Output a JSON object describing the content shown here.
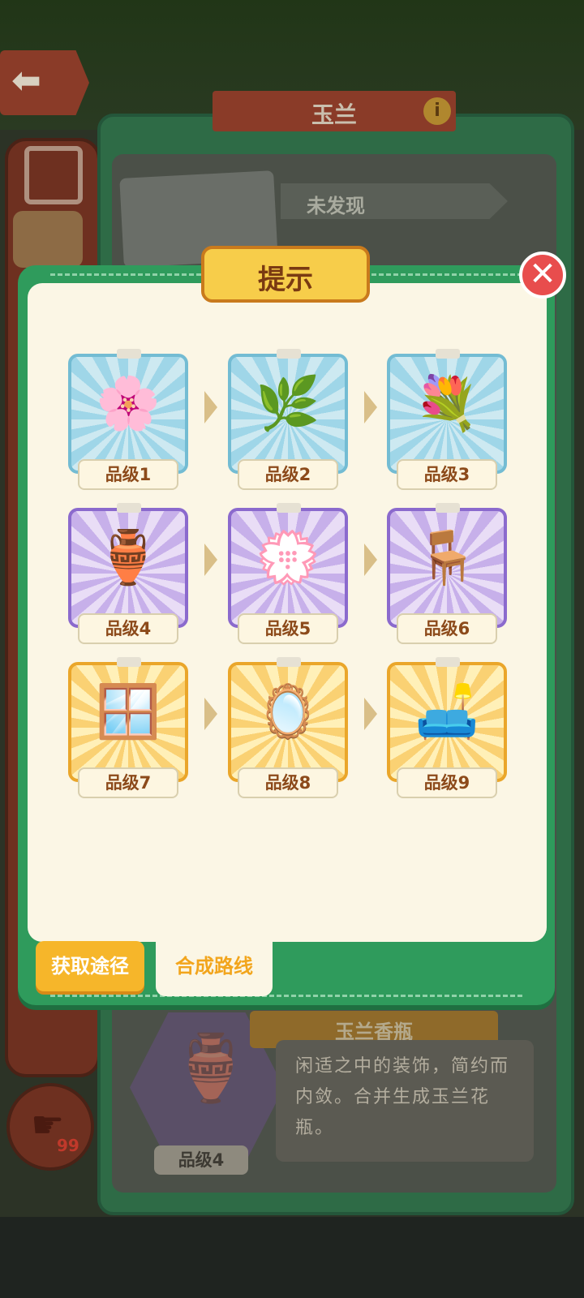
{
  "background": {
    "title": "玉兰",
    "status": "未发现",
    "item_name": "玉兰香瓶",
    "item_description": "闲适之中的装饰，简约而内敛。合并生成玉兰花瓶。",
    "item_grade": "品级4",
    "hand_count": "99"
  },
  "modal": {
    "title": "提示",
    "close_icon": "close-icon",
    "grades": [
      {
        "label": "品级1",
        "tier": "blue",
        "icon": "magnolia-bud-icon"
      },
      {
        "label": "品级2",
        "tier": "blue",
        "icon": "magnolia-branch-icon"
      },
      {
        "label": "品级3",
        "tier": "blue",
        "icon": "magnolia-bundle-icon"
      },
      {
        "label": "品级4",
        "tier": "purple",
        "icon": "magnolia-vase-icon"
      },
      {
        "label": "品级5",
        "tier": "purple",
        "icon": "magnolia-celadon-vase-icon"
      },
      {
        "label": "品级6",
        "tier": "purple",
        "icon": "magnolia-armchair-icon"
      },
      {
        "label": "品级7",
        "tier": "gold",
        "icon": "magnolia-screen-icon"
      },
      {
        "label": "品级8",
        "tier": "gold",
        "icon": "magnolia-dresser-icon"
      },
      {
        "label": "品级9",
        "tier": "gold",
        "icon": "magnolia-daybed-icon"
      }
    ],
    "tabs": {
      "obtain": "获取途径",
      "route": "合成路线"
    }
  },
  "colors": {
    "modal_green": "#2f9b5c",
    "panel_cream": "#fbf6e5",
    "title_gold": "#f7cd4a",
    "close_red": "#e84d4d",
    "tier_blue": "#73bcd3",
    "tier_purple": "#8b6acd",
    "tier_gold": "#eaa62a"
  }
}
